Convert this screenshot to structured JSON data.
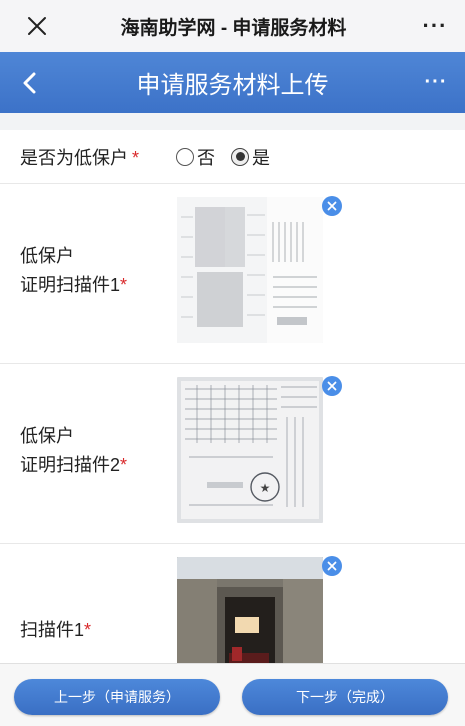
{
  "wechat": {
    "title": "海南助学网 - 申请服务材料"
  },
  "nav": {
    "title": "申请服务材料上传"
  },
  "low_income": {
    "label": "是否为低保户",
    "required_mark": "*",
    "options": [
      "否",
      "是"
    ],
    "selected": "是"
  },
  "uploads": [
    {
      "label_line1": "低保户",
      "label_line2": "证明扫描件1",
      "required_mark": "*"
    },
    {
      "label_line1": "低保户",
      "label_line2": "证明扫描件2",
      "required_mark": "*"
    },
    {
      "label_line1": "扫描件1",
      "required_mark": "*"
    }
  ],
  "footer": {
    "prev_label": "上一步（申请服务）",
    "next_label": "下一步（完成）"
  },
  "colors": {
    "nav_blue": "#4278cc",
    "button_blue": "#4580d2",
    "required_red": "#d9292b",
    "delete_blue": "#4a8ee8"
  }
}
